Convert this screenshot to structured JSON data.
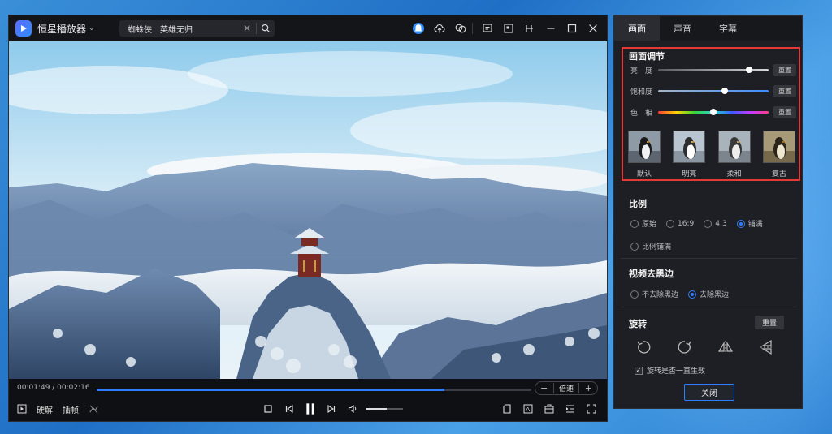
{
  "app": {
    "name": "恒星播放器",
    "search_text": "蜘蛛侠：英雄无归"
  },
  "playback": {
    "current_time": "00:01:49",
    "total_time": "00:02:16",
    "time_display": "00:01:49 / 00:02:16",
    "progress_fraction": 0.8,
    "volume_fraction": 0.55,
    "speed_label": "倍速",
    "speed_minus": "−",
    "speed_plus": "+"
  },
  "controls_left": {
    "hw_decode": "硬解",
    "frame_insert": "插帧"
  },
  "panel": {
    "tabs": [
      "画面",
      "声音",
      "字幕"
    ],
    "active_tab": "画面",
    "picture_adjust": {
      "title": "画面调节",
      "sliders": [
        {
          "label": "亮　度",
          "value": 0.82,
          "reset": "重置"
        },
        {
          "label": "饱和度",
          "value": 0.6,
          "reset": "重置"
        },
        {
          "label": "色　相",
          "value": 0.5,
          "reset": "重置"
        }
      ],
      "presets": [
        "默认",
        "明亮",
        "柔和",
        "复古"
      ]
    },
    "ratio": {
      "title": "比例",
      "options": [
        "原始",
        "16:9",
        "4:3",
        "铺满",
        "比例铺满"
      ],
      "selected": "铺满"
    },
    "black_border": {
      "title": "视频去黑边",
      "options": [
        "不去除黑边",
        "去除黑边"
      ],
      "selected": "去除黑边"
    },
    "rotate": {
      "title": "旋转",
      "reset": "重置",
      "keep_label": "旋转是否一直生效",
      "keep_checked": true
    },
    "close": "关闭"
  },
  "colors": {
    "accent": "#2e7dff",
    "highlight_border": "#e53935",
    "panel_bg": "#1e1f24",
    "player_bg": "#101114"
  }
}
